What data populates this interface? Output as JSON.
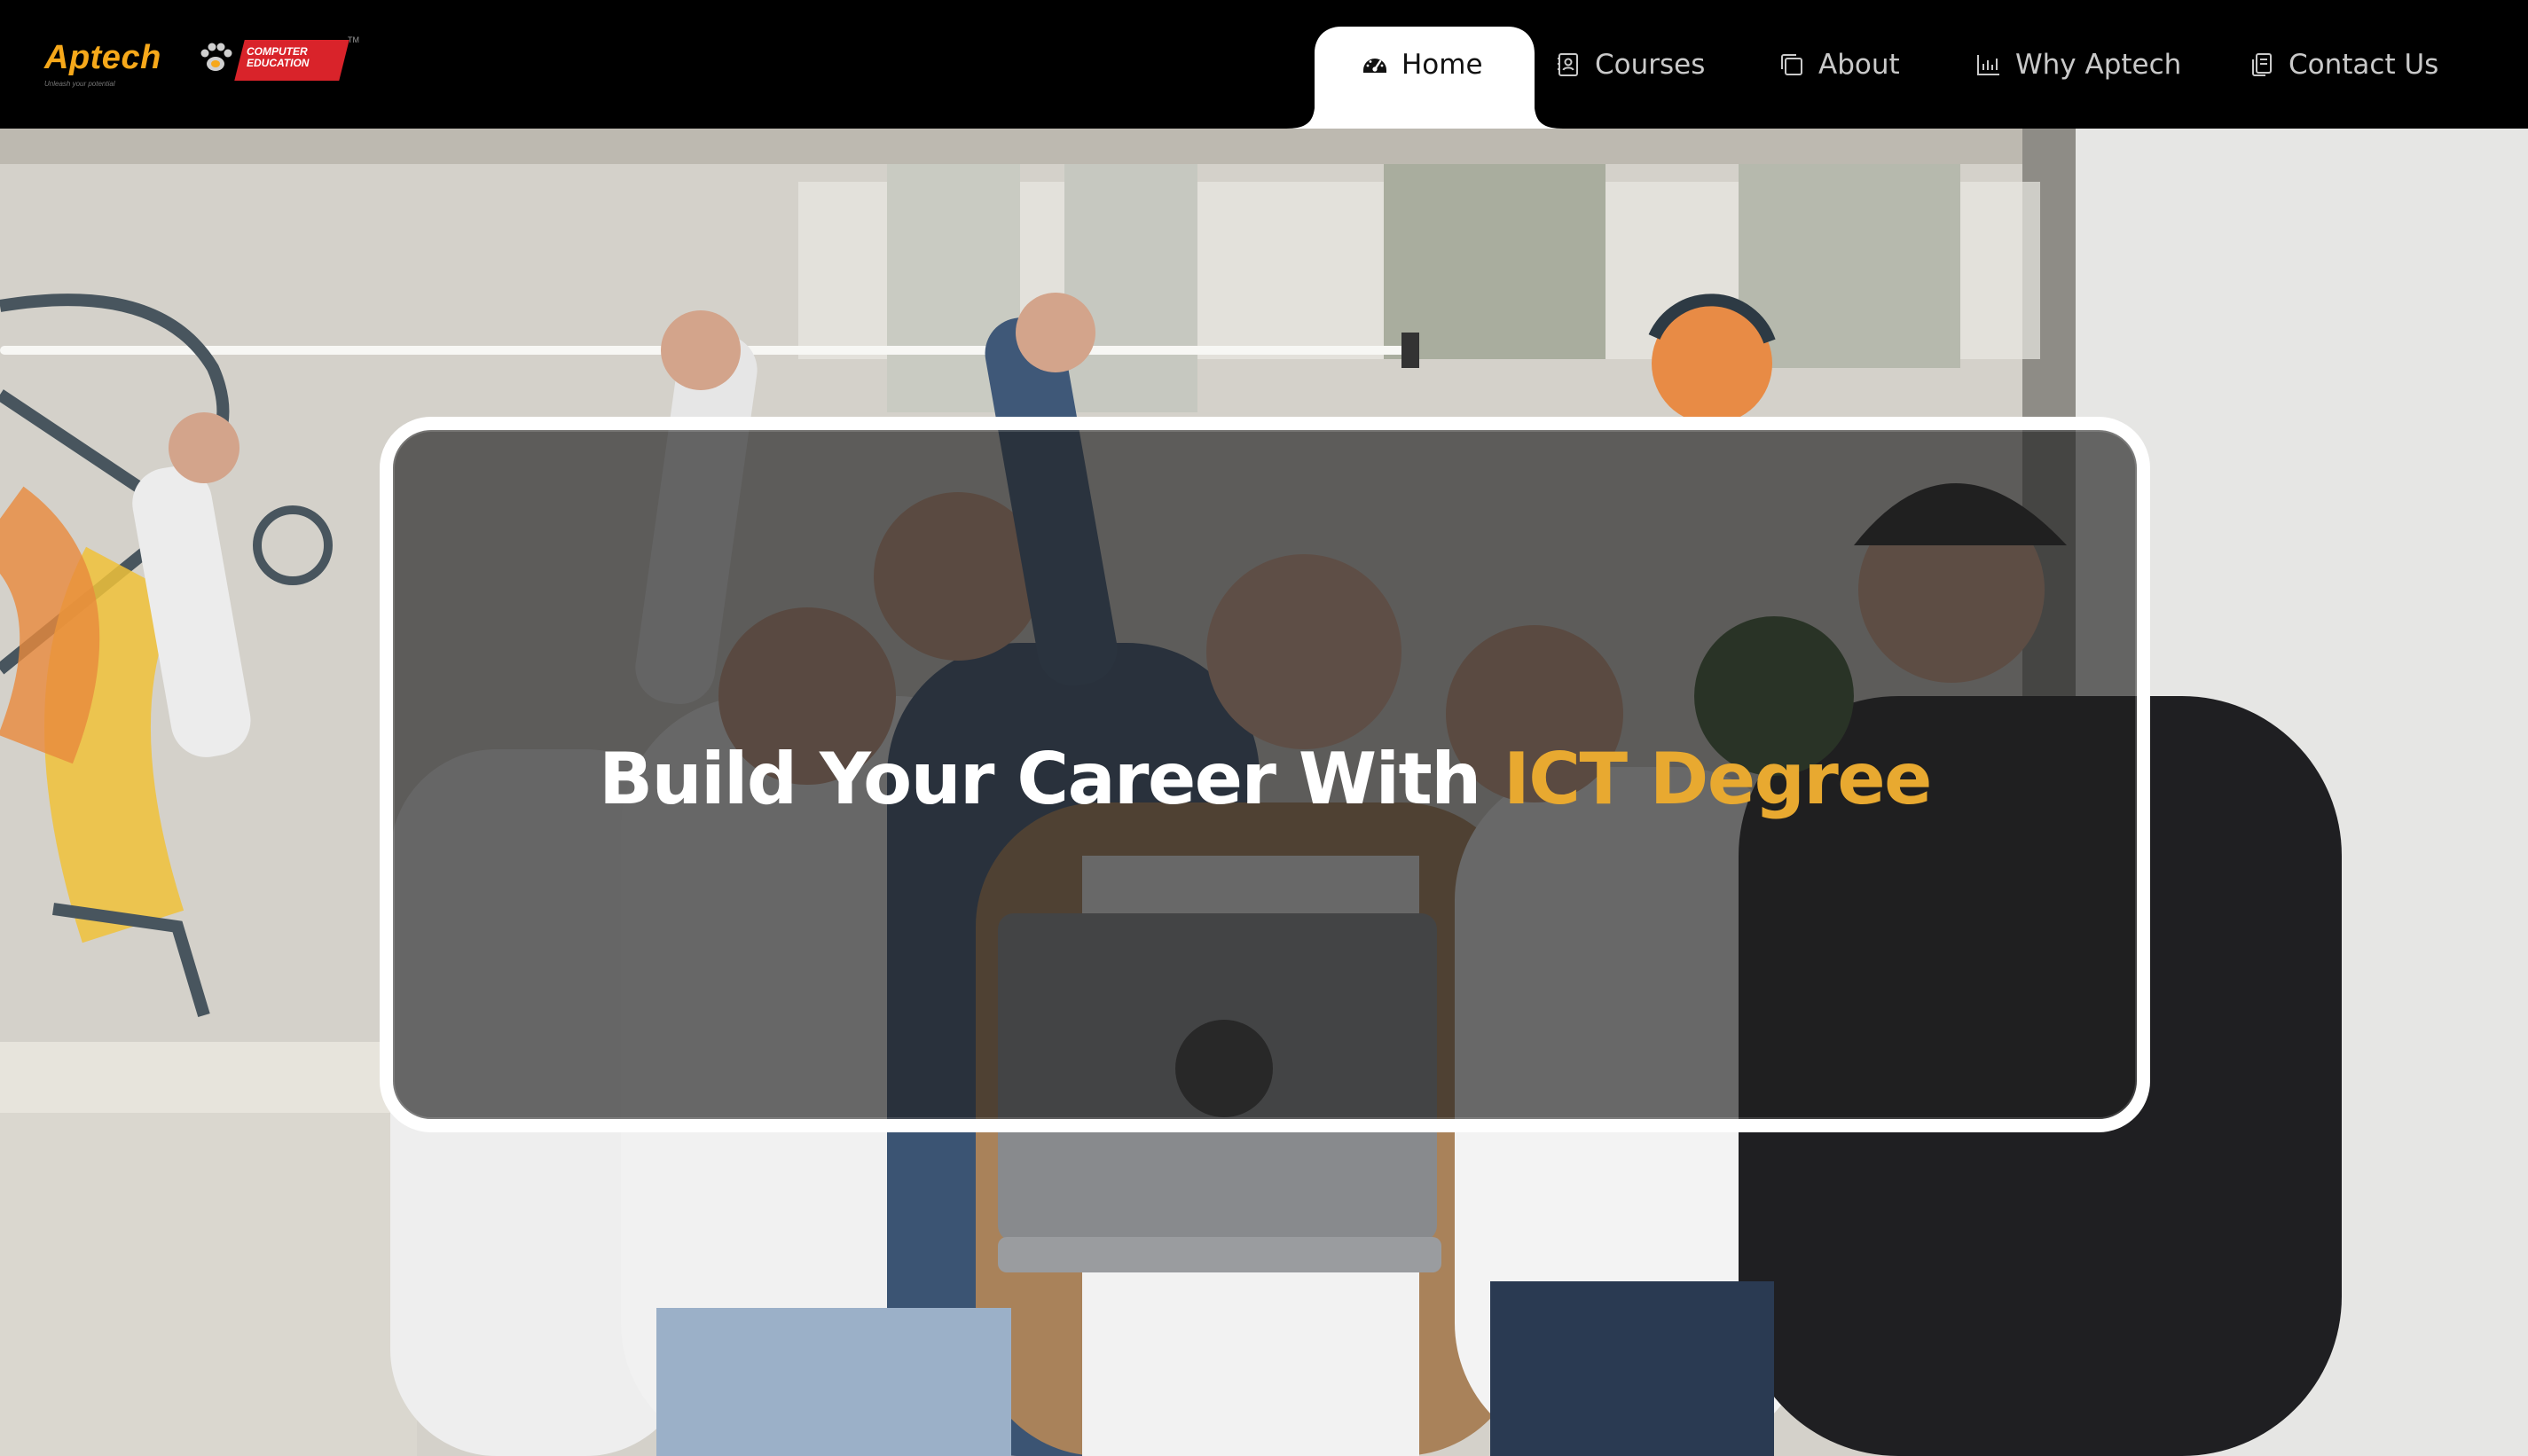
{
  "brand": {
    "name": "Aptech",
    "badge_line1": "Computer",
    "badge_line2": "Education",
    "tagline": "Unleash your potential",
    "trademark": "TM"
  },
  "nav": {
    "items": [
      {
        "label": "Home",
        "icon": "dashboard-icon",
        "active": true
      },
      {
        "label": "Courses",
        "icon": "contact-card-icon",
        "active": false
      },
      {
        "label": "About",
        "icon": "copy-square-icon",
        "active": false
      },
      {
        "label": "Why Aptech",
        "icon": "bar-chart-icon",
        "active": false
      },
      {
        "label": "Contact Us",
        "icon": "copy-document-icon",
        "active": false
      }
    ]
  },
  "hero": {
    "headline_main": "Build Your Career With ",
    "headline_accent": "ICT Degree",
    "background": "group-of-students-celebrating-photo"
  },
  "colors": {
    "navbar_bg": "#000000",
    "nav_text": "#c9c9c9",
    "active_tab_bg": "#ffffff",
    "brand_orange": "#f6a81a",
    "brand_red": "#d9232a",
    "accent": "#e8a930",
    "card_border": "#ffffff"
  }
}
